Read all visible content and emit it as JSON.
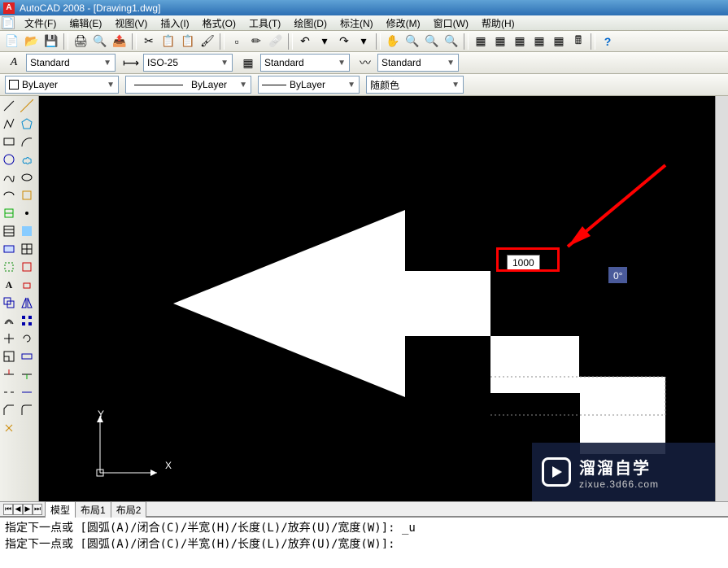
{
  "brand_cn": "溜溜自学",
  "brand_en": "zixue.3d66.com",
  "cmd2": "指定下一点或 [圆弧(A)/闭合(C)/半宽(H)/长度(L)/放弃(U)/宽度(W)]:",
  "tabs": {
    "model": "模型",
    "layout1": "布局1",
    "layout2": "布局2"
  },
  "dd": {
    "textstyle": "Standard",
    "dimstyle": "ISO-25",
    "tablestyle": "Standard",
    "mlstyle": "Standard",
    "layer": "ByLayer",
    "linetype": "ByLayer",
    "lineweight": "ByLayer",
    "color": "随颜色"
  },
  "cmd1": "指定下一点或 [圆弧(A)/闭合(C)/半宽(H)/长度(L)/放弃(U)/宽度(W)]: _u",
  "menu": {
    "file": "文件(F)",
    "edit": "编辑(E)",
    "view": "视图(V)",
    "insert": "插入(I)",
    "format": "格式(O)",
    "tools": "工具(T)",
    "draw": "绘图(D)",
    "dimension": "标注(N)",
    "modify": "修改(M)",
    "window": "窗口(W)",
    "help": "帮助(H)"
  },
  "dyn": {
    "length": "1000",
    "angle": "0°"
  },
  "axis": {
    "x": "X",
    "y": "Y"
  },
  "app": {
    "title": "AutoCAD 2008 - [Drawing1.dwg]",
    "icon_letter": "A"
  }
}
